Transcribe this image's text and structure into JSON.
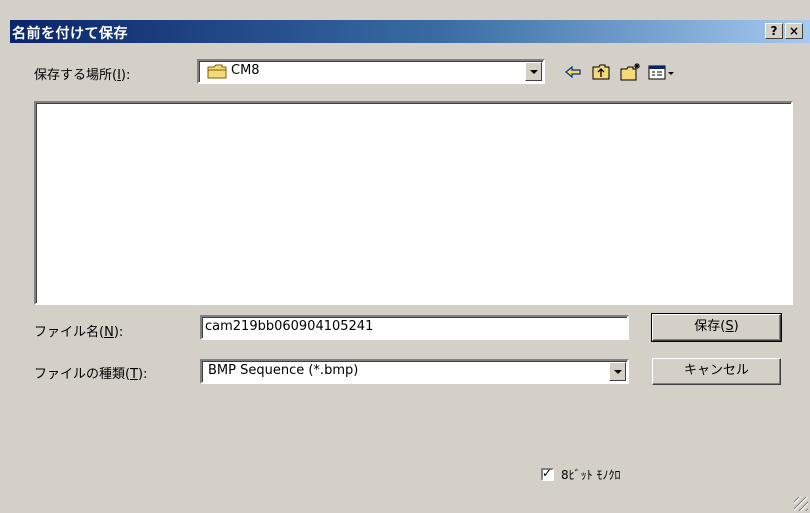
{
  "window": {
    "title": "名前を付けて保存",
    "help_button": "?",
    "close_button": "×"
  },
  "location": {
    "label_prefix": "保存する場所(",
    "label_accel": "I",
    "label_suffix": "):",
    "selected": "CM8"
  },
  "toolbar": {
    "back_icon": "back-arrow-icon",
    "up_icon": "up-folder-icon",
    "new_folder_icon": "new-folder-icon",
    "view_menu_icon": "view-menu-icon"
  },
  "file_name": {
    "label_prefix": "ファイル名(",
    "label_accel": "N",
    "label_suffix": "):",
    "value": "cam219bb060904105241"
  },
  "file_type": {
    "label_prefix": "ファイルの種類(",
    "label_accel": "T",
    "label_suffix": "):",
    "selected": "BMP Sequence (*.bmp)"
  },
  "buttons": {
    "save_prefix": "保存(",
    "save_accel": "S",
    "save_suffix": ")",
    "cancel": "キャンセル"
  },
  "options": {
    "mono8_label": "8ﾋﾞｯﾄ ﾓﾉｸﾛ",
    "mono8_checked": true
  }
}
